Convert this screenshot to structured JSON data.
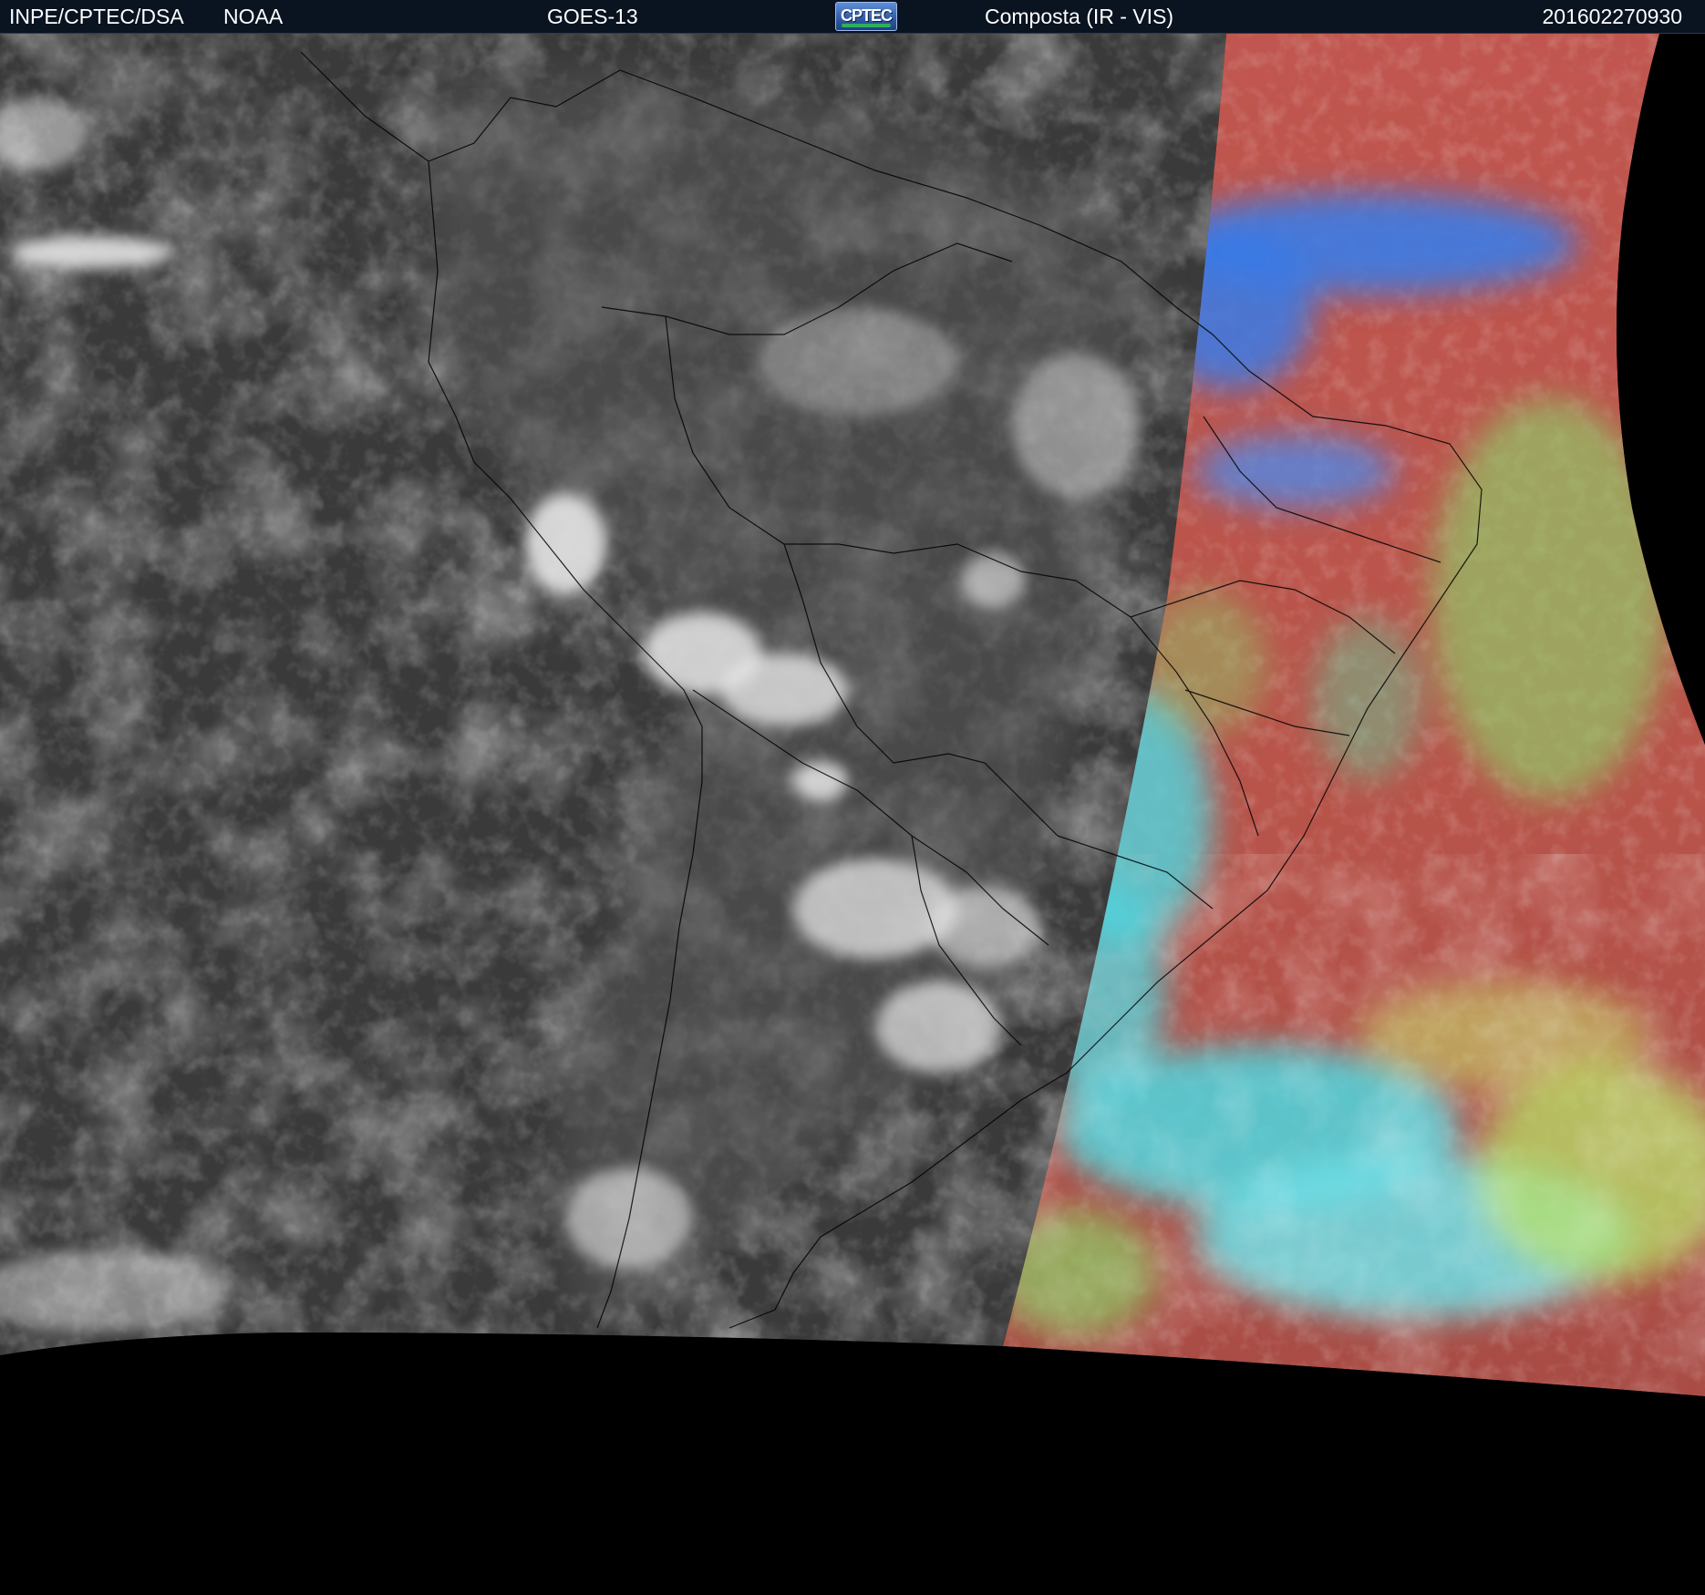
{
  "header": {
    "agency": "INPE/CPTEC/DSA",
    "source": "NOAA",
    "satellite": "GOES-13",
    "logo_text": "CPTEC",
    "product": "Composta (IR - VIS)",
    "timestamp": "201602270930"
  },
  "colors": {
    "header_background": "#0a1320",
    "header_text": "#ffffff",
    "space_background": "#000000",
    "ir_night_gray": "#3a3a3a",
    "cloud_white": "#e6e6e6",
    "vis_day_red": "#b8544a",
    "vis_day_cyan": "#4fd7e0",
    "vis_day_blue": "#3a7be6",
    "vis_day_green": "#8fcf6a"
  },
  "icons": {
    "logo": "cptec-logo-icon"
  }
}
